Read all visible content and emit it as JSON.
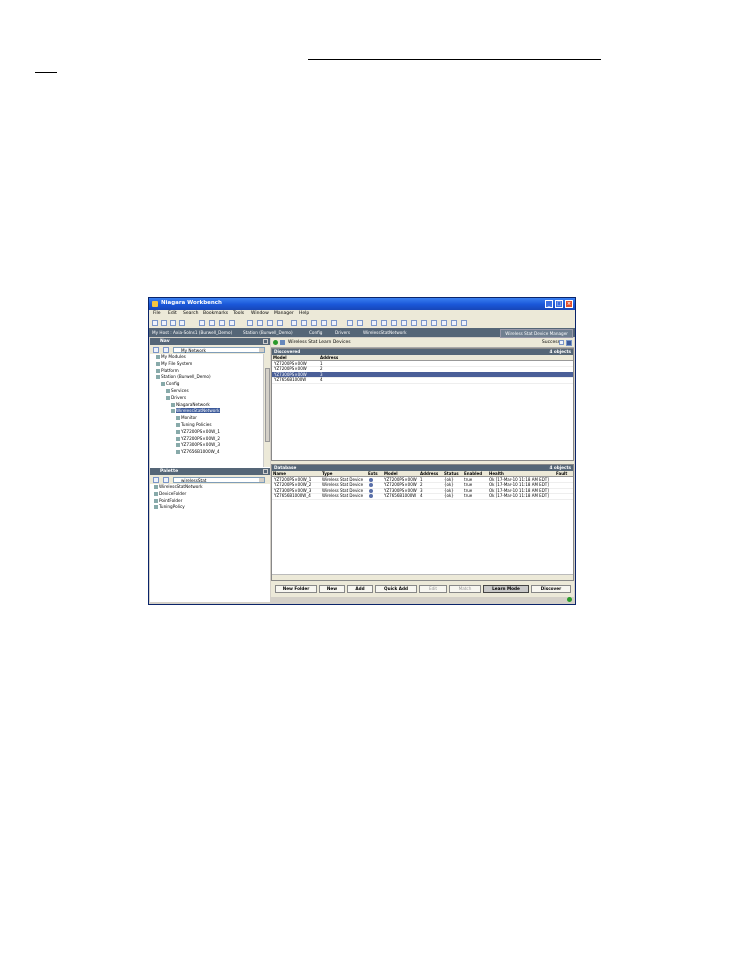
{
  "window": {
    "title": "Niagara Workbench",
    "controls": {
      "minimize": "_",
      "maximize": "□",
      "close": "×"
    }
  },
  "menu": [
    "File",
    "Edit",
    "Search",
    "Bookmarks",
    "Tools",
    "Window",
    "Manager",
    "Help"
  ],
  "locator": {
    "crumbs": [
      "My Host : Axia-Solns1 (Burwell_Demo)",
      "Station (Burwell_Demo)",
      "Config",
      "Drivers",
      "WirelessStatNetwork"
    ],
    "view_menu": "Wireless Stat Device Manager"
  },
  "nav": {
    "title": "Nav",
    "selector": "My Network",
    "tree": [
      {
        "label": "My Modules",
        "depth": 0
      },
      {
        "label": "My File System",
        "depth": 0
      },
      {
        "label": "Platform",
        "depth": 0
      },
      {
        "label": "Station (Burwell_Demo)",
        "depth": 0
      },
      {
        "label": "Config",
        "depth": 1
      },
      {
        "label": "Services",
        "depth": 2
      },
      {
        "label": "Drivers",
        "depth": 2
      },
      {
        "label": "NiagaraNetwork",
        "depth": 3
      },
      {
        "label": "WirelessStatNetwork",
        "depth": 3,
        "selected": true
      },
      {
        "label": "Monitor",
        "depth": 4
      },
      {
        "label": "Tuning Policies",
        "depth": 4
      },
      {
        "label": "YZ7200PS×00W_1",
        "depth": 4
      },
      {
        "label": "YZ7200PS×00W_2",
        "depth": 4
      },
      {
        "label": "YZ7300PS×00W_3",
        "depth": 4
      },
      {
        "label": "YZ7656B1000W_4",
        "depth": 4
      }
    ]
  },
  "palette": {
    "title": "Palette",
    "selector": "wirelessStat",
    "tree": [
      {
        "label": "WirelessStatNetwork"
      },
      {
        "label": "DeviceFolder"
      },
      {
        "label": "PointFolder"
      },
      {
        "label": "TuningPolicy"
      }
    ]
  },
  "manager": {
    "title": "Wireless Stat Learn Devices",
    "status": "Success"
  },
  "discovered": {
    "title": "Discovered",
    "count": "4 objects",
    "columns": [
      "Model",
      "Address"
    ],
    "rows": [
      {
        "model": "YZ7200PS×00W",
        "address": "1"
      },
      {
        "model": "YZ7200PS×00W",
        "address": "2"
      },
      {
        "model": "YZ7300PS×00W",
        "address": "3",
        "selected": true
      },
      {
        "model": "YZ7656B1000W",
        "address": "4"
      }
    ]
  },
  "database": {
    "title": "Database",
    "count": "4 objects",
    "columns": [
      "Name",
      "Type",
      "Exts",
      "Model",
      "Address",
      "Status",
      "Enabled",
      "Health",
      "Fault"
    ],
    "rows": [
      {
        "name": "YZ7200PS×00W_1",
        "type": "Wireless Stat Device",
        "model": "YZ7200PS×00W",
        "address": "1",
        "status": "{ok}",
        "enabled": "true",
        "health": "Ok [17-Mar-10 11:18 AM EDT]"
      },
      {
        "name": "YZ7200PS×00W_2",
        "type": "Wireless Stat Device",
        "model": "YZ7200PS×00W",
        "address": "2",
        "status": "{ok}",
        "enabled": "true",
        "health": "Ok [17-Mar-10 11:18 AM EDT]"
      },
      {
        "name": "YZ7300PS×00W_3",
        "type": "Wireless Stat Device",
        "model": "YZ7300PS×00W",
        "address": "3",
        "status": "{ok}",
        "enabled": "true",
        "health": "Ok [17-Mar-10 11:18 AM EDT]"
      },
      {
        "name": "YZ7656B1000W_4",
        "type": "Wireless Stat Device",
        "model": "YZ7656B1000W",
        "address": "4",
        "status": "{ok}",
        "enabled": "true",
        "health": "Ok [17-Mar-10 11:18 AM EDT]"
      }
    ]
  },
  "buttons": {
    "new_folder": "New Folder",
    "new": "New",
    "add": "Add",
    "quick_add": "Quick Add",
    "edit": "Edit",
    "match": "Match",
    "learn_mode": "Learn Mode",
    "discover": "Discover"
  },
  "colors": {
    "titlebar": "#1a56d8",
    "panel_header": "#556677",
    "selection": "#4a5f98",
    "status_ok": "#2a9a2a"
  }
}
